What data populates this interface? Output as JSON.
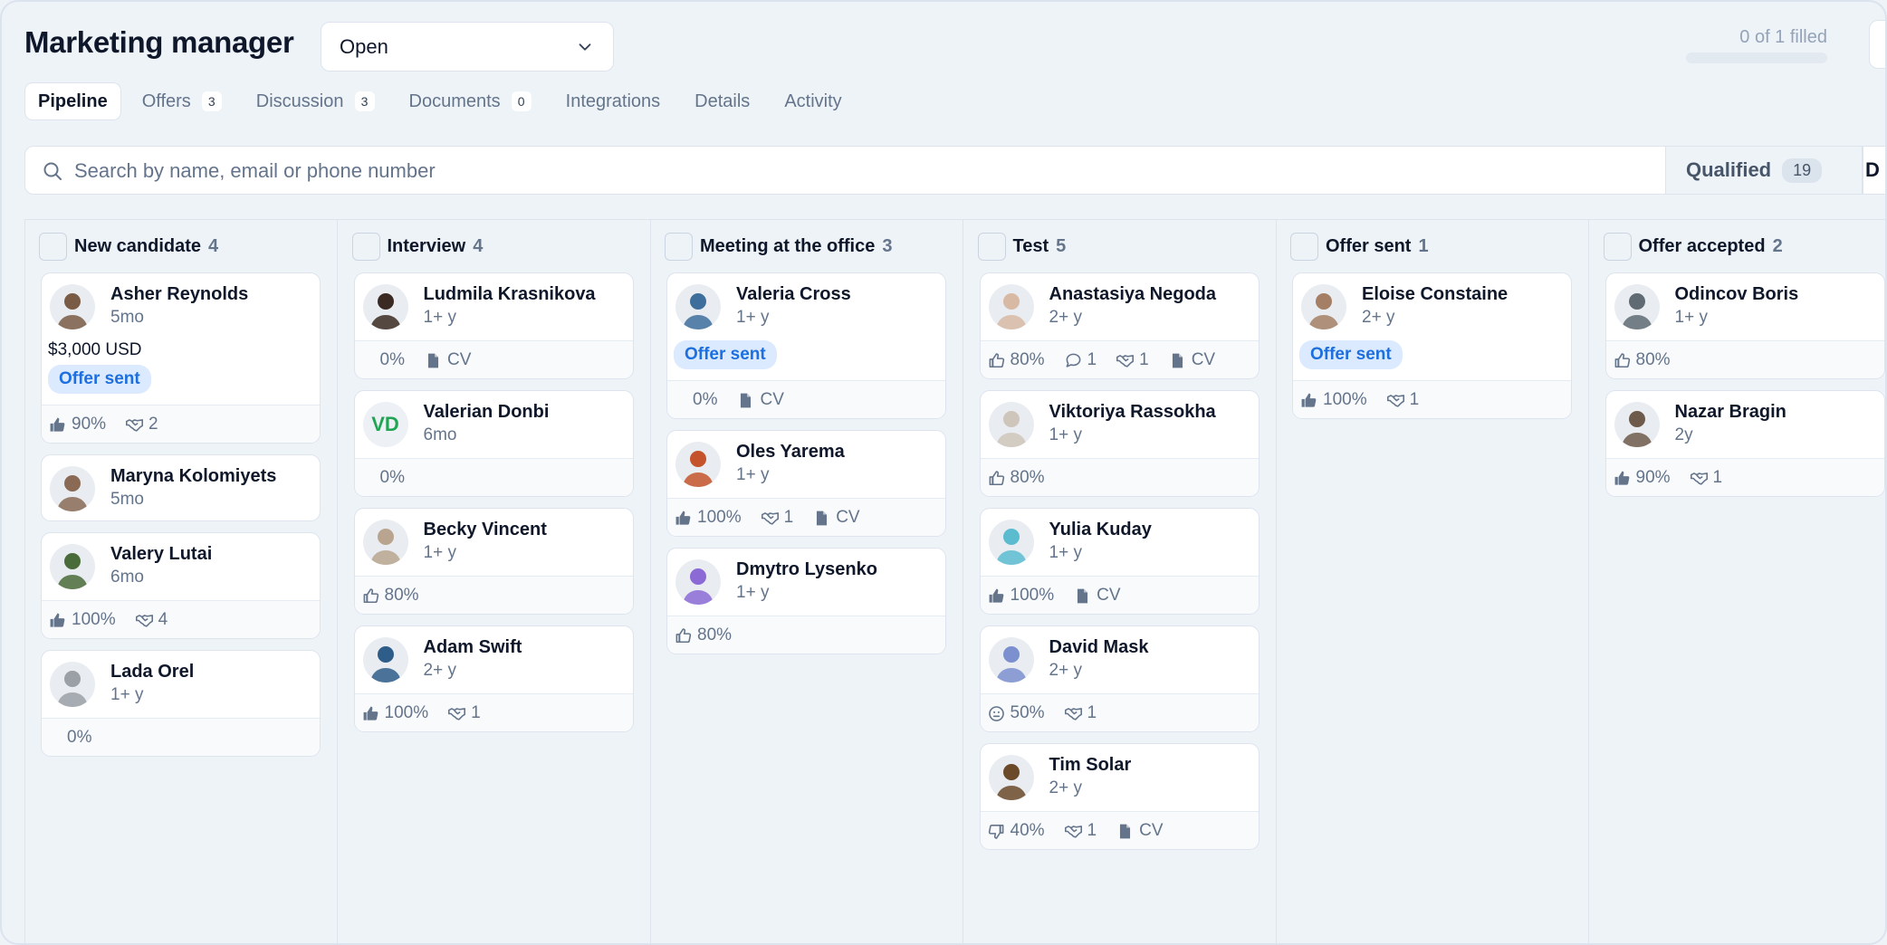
{
  "header": {
    "title": "Marketing manager",
    "status_value": "Open",
    "filled_text": "0 of 1 filled"
  },
  "tabs": [
    {
      "label": "Pipeline",
      "count": null,
      "active": true
    },
    {
      "label": "Offers",
      "count": "3"
    },
    {
      "label": "Discussion",
      "count": "3"
    },
    {
      "label": "Documents",
      "count": "0"
    },
    {
      "label": "Integrations",
      "count": null
    },
    {
      "label": "Details",
      "count": null
    },
    {
      "label": "Activity",
      "count": null
    }
  ],
  "search": {
    "placeholder": "Search by name, email or phone number",
    "qualified_label": "Qualified",
    "qualified_count": "19",
    "next_segment_label": "D"
  },
  "colors": {
    "accent_blue": "#1d6fe0",
    "badge_bg": "#dbeafe",
    "initials_green": "#22a455",
    "muted_text": "#64748b"
  },
  "columns": [
    {
      "title": "New candidate",
      "count": "4",
      "cards": [
        {
          "name": "Asher Reynolds",
          "exp": "5mo",
          "salary": "$3,000 USD",
          "badge": "Offer sent",
          "avatar_color": "#7a5b45",
          "stats": [
            {
              "icon": "thumbs-up-icon",
              "text": "90%"
            },
            {
              "icon": "handshake-icon",
              "text": "2"
            }
          ]
        },
        {
          "name": "Maryna Kolomiyets",
          "exp": "5mo",
          "avatar_color": "#8a6a55",
          "stats": []
        },
        {
          "name": "Valery Lutai",
          "exp": "6mo",
          "avatar_color": "#4a6b3a",
          "stats": [
            {
              "icon": "thumbs-up-icon",
              "text": "100%"
            },
            {
              "icon": "handshake-icon",
              "text": "4"
            }
          ]
        },
        {
          "name": "Lada Orel",
          "exp": "1+ y",
          "avatar_color": "#9aa0a6",
          "stats": [
            {
              "icon": "none",
              "text": "0%"
            }
          ]
        }
      ]
    },
    {
      "title": "Interview",
      "count": "4",
      "cards": [
        {
          "name": "Ludmila Krasnikova",
          "exp": "1+ y",
          "avatar_color": "#3b2a22",
          "stats": [
            {
              "icon": "none",
              "text": "0%"
            },
            {
              "icon": "document-icon",
              "text": "CV"
            }
          ]
        },
        {
          "name": "Valerian Donbi",
          "exp": "6mo",
          "initials": "VD",
          "stats": [
            {
              "icon": "none",
              "text": "0%"
            }
          ]
        },
        {
          "name": "Becky Vincent",
          "exp": "1+ y",
          "avatar_color": "#b9a58f",
          "stats": [
            {
              "icon": "thumbs-up-outline-icon",
              "text": "80%"
            }
          ]
        },
        {
          "name": "Adam Swift",
          "exp": "2+ y",
          "avatar_color": "#2f5d8a",
          "stats": [
            {
              "icon": "thumbs-up-icon",
              "text": "100%"
            },
            {
              "icon": "handshake-icon",
              "text": "1"
            }
          ]
        }
      ]
    },
    {
      "title": "Meeting at the office",
      "count": "3",
      "cards": [
        {
          "name": "Valeria Cross",
          "exp": "1+ y",
          "badge": "Offer sent",
          "avatar_color": "#3e6f9c",
          "stats": [
            {
              "icon": "none",
              "text": "0%"
            },
            {
              "icon": "document-icon",
              "text": "CV"
            }
          ]
        },
        {
          "name": "Oles Yarema",
          "exp": "1+ y",
          "avatar_color": "#c4532c",
          "stats": [
            {
              "icon": "thumbs-up-icon",
              "text": "100%"
            },
            {
              "icon": "handshake-icon",
              "text": "1"
            },
            {
              "icon": "document-icon",
              "text": "CV"
            }
          ]
        },
        {
          "name": "Dmytro Lysenko",
          "exp": "1+ y",
          "avatar_color": "#8b6ad6",
          "stats": [
            {
              "icon": "thumbs-up-outline-icon",
              "text": "80%"
            }
          ]
        }
      ]
    },
    {
      "title": "Test",
      "count": "5",
      "cards": [
        {
          "name": "Anastasiya Negoda",
          "exp": "2+ y",
          "avatar_color": "#d8b9a4",
          "stats": [
            {
              "icon": "thumbs-up-outline-icon",
              "text": "80%"
            },
            {
              "icon": "comment-icon",
              "text": "1"
            },
            {
              "icon": "handshake-icon",
              "text": "1"
            },
            {
              "icon": "document-icon",
              "text": "CV"
            }
          ]
        },
        {
          "name": "Viktoriya Rassokha",
          "exp": "1+ y",
          "avatar_color": "#cfc6bb",
          "stats": [
            {
              "icon": "thumbs-up-outline-icon",
              "text": "80%"
            }
          ]
        },
        {
          "name": "Yulia Kuday",
          "exp": "1+ y",
          "avatar_color": "#5bbcd0",
          "stats": [
            {
              "icon": "thumbs-up-icon",
              "text": "100%"
            },
            {
              "icon": "document-icon",
              "text": "CV"
            }
          ]
        },
        {
          "name": "David Mask",
          "exp": "2+ y",
          "avatar_color": "#7c8fcf",
          "stats": [
            {
              "icon": "neutral-face-icon",
              "text": "50%"
            },
            {
              "icon": "handshake-icon",
              "text": "1"
            }
          ]
        },
        {
          "name": "Tim Solar",
          "exp": "2+ y",
          "avatar_color": "#6b4a2a",
          "stats": [
            {
              "icon": "thumbs-down-outline-icon",
              "text": "40%"
            },
            {
              "icon": "handshake-icon",
              "text": "1"
            },
            {
              "icon": "document-icon",
              "text": "CV"
            }
          ]
        }
      ]
    },
    {
      "title": "Offer sent",
      "count": "1",
      "cards": [
        {
          "name": "Eloise Constaine",
          "exp": "2+ y",
          "badge": "Offer sent",
          "avatar_color": "#a47f66",
          "stats": [
            {
              "icon": "thumbs-up-icon",
              "text": "100%"
            },
            {
              "icon": "handshake-icon",
              "text": "1"
            }
          ]
        }
      ]
    },
    {
      "title": "Offer accepted",
      "count": "2",
      "cards": [
        {
          "name": "Odincov Boris",
          "exp": "1+ y",
          "avatar_color": "#5f6a73",
          "stats": [
            {
              "icon": "thumbs-up-outline-icon",
              "text": "80%"
            }
          ]
        },
        {
          "name": "Nazar Bragin",
          "exp": "2y",
          "avatar_color": "#6e5a4b",
          "stats": [
            {
              "icon": "thumbs-up-icon",
              "text": "90%"
            },
            {
              "icon": "handshake-icon",
              "text": "1"
            }
          ]
        }
      ]
    }
  ]
}
